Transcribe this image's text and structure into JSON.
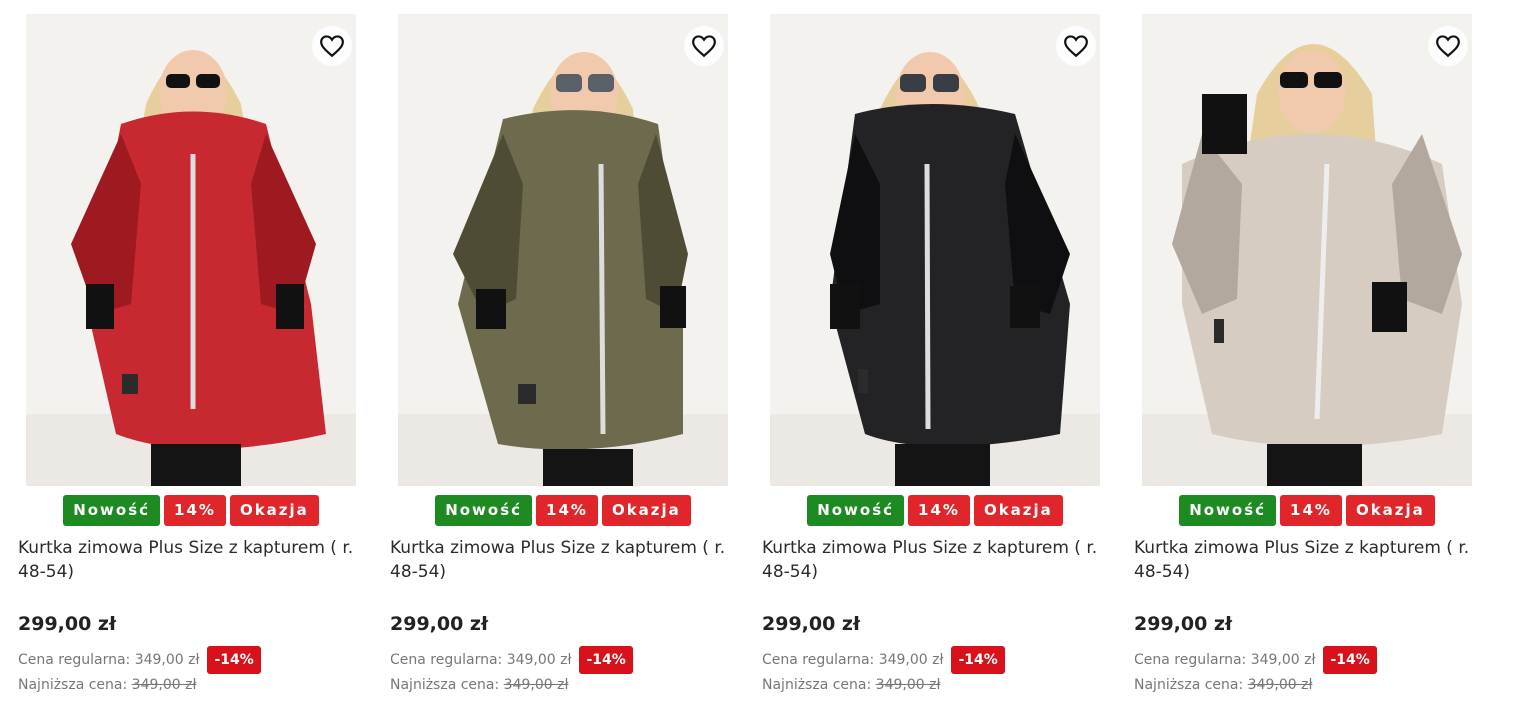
{
  "products": [
    {
      "image_alt": "red jacket",
      "coat_color": "#c8282f",
      "coat_shade": "#9e1a20",
      "badges": [
        {
          "label": "Nowość",
          "color": "green"
        },
        {
          "label": "14%",
          "color": "red"
        },
        {
          "label": "Okazja",
          "color": "red"
        }
      ],
      "name": "Kurtka zimowa Plus Size z kapturem ( r. 48-54)",
      "price": "299,00 zł",
      "regular_label": "Cena regularna: 349,00 zł",
      "discount": "-14%",
      "lowest_label": "Najniższa cena:",
      "lowest_value": "349,00 zł"
    },
    {
      "image_alt": "khaki jacket",
      "coat_color": "#6e6a4e",
      "coat_shade": "#4f4c36",
      "badges": [
        {
          "label": "Nowość",
          "color": "green"
        },
        {
          "label": "14%",
          "color": "red"
        },
        {
          "label": "Okazja",
          "color": "red"
        }
      ],
      "name": "Kurtka zimowa Plus Size z kapturem ( r. 48-54)",
      "price": "299,00 zł",
      "regular_label": "Cena regularna: 349,00 zł",
      "discount": "-14%",
      "lowest_label": "Najniższa cena:",
      "lowest_value": "349,00 zł"
    },
    {
      "image_alt": "black jacket",
      "coat_color": "#232326",
      "coat_shade": "#0f0f11",
      "badges": [
        {
          "label": "Nowość",
          "color": "green"
        },
        {
          "label": "14%",
          "color": "red"
        },
        {
          "label": "Okazja",
          "color": "red"
        }
      ],
      "name": "Kurtka zimowa Plus Size z kapturem ( r. 48-54)",
      "price": "299,00 zł",
      "regular_label": "Cena regularna: 349,00 zł",
      "discount": "-14%",
      "lowest_label": "Najniższa cena:",
      "lowest_value": "349,00 zł"
    },
    {
      "image_alt": "beige jacket",
      "coat_color": "#d6ccc2",
      "coat_shade": "#b3a89d",
      "badges": [
        {
          "label": "Nowość",
          "color": "green"
        },
        {
          "label": "14%",
          "color": "red"
        },
        {
          "label": "Okazja",
          "color": "red"
        }
      ],
      "name": "Kurtka zimowa Plus Size z kapturem ( r. 48-54)",
      "price": "299,00 zł",
      "regular_label": "Cena regularna: 349,00 zł",
      "discount": "-14%",
      "lowest_label": "Najniższa cena:",
      "lowest_value": "349,00 zł"
    }
  ],
  "icons": {
    "favorite": "heart-outline-icon"
  },
  "colors": {
    "badge_green": "#1e8a22",
    "badge_red": "#e0262b",
    "discount_red": "#d9111b"
  }
}
